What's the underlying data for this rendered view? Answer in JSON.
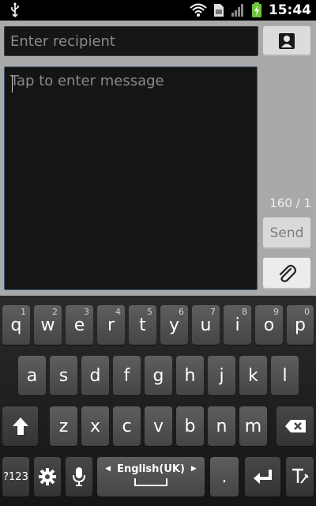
{
  "status_bar": {
    "time": "15:44",
    "icons": [
      "usb-icon",
      "wifi-icon",
      "sim-icon",
      "signal-icon",
      "battery-charging-icon"
    ]
  },
  "compose": {
    "recipient_placeholder": "Enter recipient",
    "message_placeholder": "Tap to enter message",
    "counter": "160 / 1",
    "send_label": "Send",
    "contact_icon": "contact-icon",
    "attach_icon": "paperclip-icon"
  },
  "keyboard": {
    "row1": [
      {
        "label": "q",
        "hint": "1"
      },
      {
        "label": "w",
        "hint": "2"
      },
      {
        "label": "e",
        "hint": "3"
      },
      {
        "label": "r",
        "hint": "4"
      },
      {
        "label": "t",
        "hint": "5"
      },
      {
        "label": "y",
        "hint": "6"
      },
      {
        "label": "u",
        "hint": "7"
      },
      {
        "label": "i",
        "hint": "8"
      },
      {
        "label": "o",
        "hint": "9"
      },
      {
        "label": "p",
        "hint": "0"
      }
    ],
    "row2": [
      "a",
      "s",
      "d",
      "f",
      "g",
      "h",
      "j",
      "k",
      "l"
    ],
    "row3": [
      "z",
      "x",
      "c",
      "v",
      "b",
      "n",
      "m"
    ],
    "symbols_label": "?123",
    "language_label": "English(UK)",
    "period_label": "."
  }
}
